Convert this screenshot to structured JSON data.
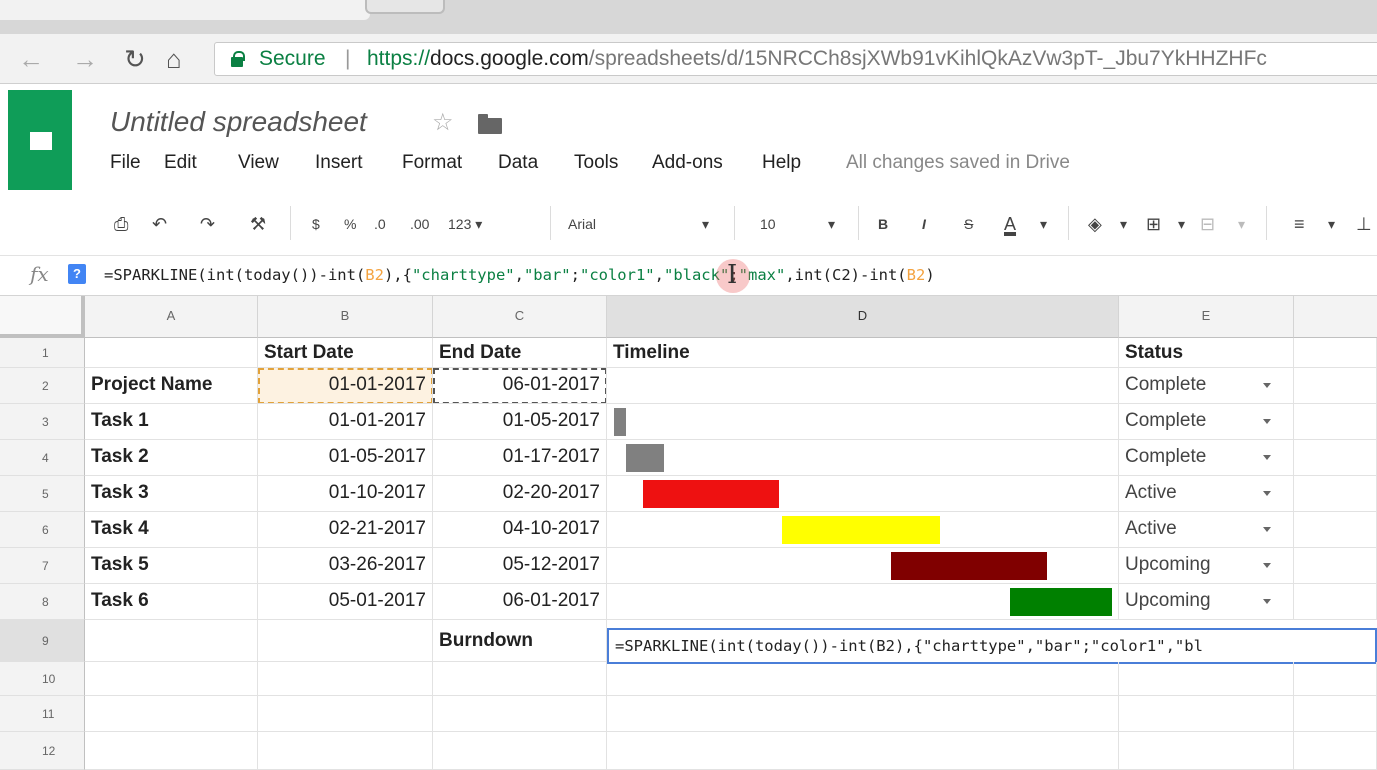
{
  "browser": {
    "secure_label": "Secure",
    "separator": "|",
    "url_scheme": "https://",
    "url_host": "docs.google.com",
    "url_path": "/spreadsheets/d/15NRCCh8sjXWb91vKihlQkAzVw3pT-_Jbu7YkHHZHFc"
  },
  "doc": {
    "title": "Untitled spreadsheet",
    "menu": [
      "File",
      "Edit",
      "View",
      "Insert",
      "Format",
      "Data",
      "Tools",
      "Add-ons",
      "Help"
    ],
    "saved_status": "All changes saved in Drive"
  },
  "toolbar": {
    "currency": "$",
    "percent": "%",
    "dec_decrease": ".0",
    "dec_increase": ".00",
    "more_formats": "123",
    "font_family": "Arial",
    "font_size": "10",
    "bold": "B",
    "italic": "I",
    "strike": "S",
    "text_color": "A"
  },
  "formula_bar": {
    "fx_label": "fx",
    "help_label": "?",
    "parts": {
      "p1": "=SPARKLINE(int(today())-int(",
      "ref1": "B2",
      "p2": "),{",
      "s1": "\"charttype\"",
      "p3": ",",
      "s2": "\"bar\"",
      "p4": ";",
      "s3": "\"color1\"",
      "p5": ",",
      "s4": "\"black\"",
      "p6": ";",
      "s5": "\"max\"",
      "p7": ",int(C2)-int(",
      "ref2": "B2",
      "p8": ")"
    }
  },
  "sheet": {
    "columns": [
      "A",
      "B",
      "C",
      "D",
      "E"
    ],
    "row_numbers": [
      "1",
      "2",
      "3",
      "4",
      "5",
      "6",
      "7",
      "8",
      "9",
      "10",
      "11",
      "12"
    ],
    "headers": {
      "b": "Start Date",
      "c": "End Date",
      "d": "Timeline",
      "e": "Status"
    },
    "rows": [
      {
        "name": "Project Name",
        "start": "01-01-2017",
        "end": "06-01-2017",
        "status": "Complete"
      },
      {
        "name": "Task 1",
        "start": "01-01-2017",
        "end": "01-05-2017",
        "status": "Complete",
        "bar_color": "#808080"
      },
      {
        "name": "Task 2",
        "start": "01-05-2017",
        "end": "01-17-2017",
        "status": "Complete",
        "bar_color": "#808080"
      },
      {
        "name": "Task 3",
        "start": "01-10-2017",
        "end": "02-20-2017",
        "status": "Active",
        "bar_color": "#ee1111"
      },
      {
        "name": "Task 4",
        "start": "02-21-2017",
        "end": "04-10-2017",
        "status": "Active",
        "bar_color": "#ffff00"
      },
      {
        "name": "Task 5",
        "start": "03-26-2017",
        "end": "05-12-2017",
        "status": "Upcoming",
        "bar_color": "#800000"
      },
      {
        "name": "Task 6",
        "start": "05-01-2017",
        "end": "06-01-2017",
        "status": "Upcoming",
        "bar_color": "#008000"
      }
    ],
    "burndown_label": "Burndown",
    "active_cell_text": "=SPARKLINE(int(today())-int(B2),{\"charttype\",\"bar\";\"color1\",\"bl"
  }
}
